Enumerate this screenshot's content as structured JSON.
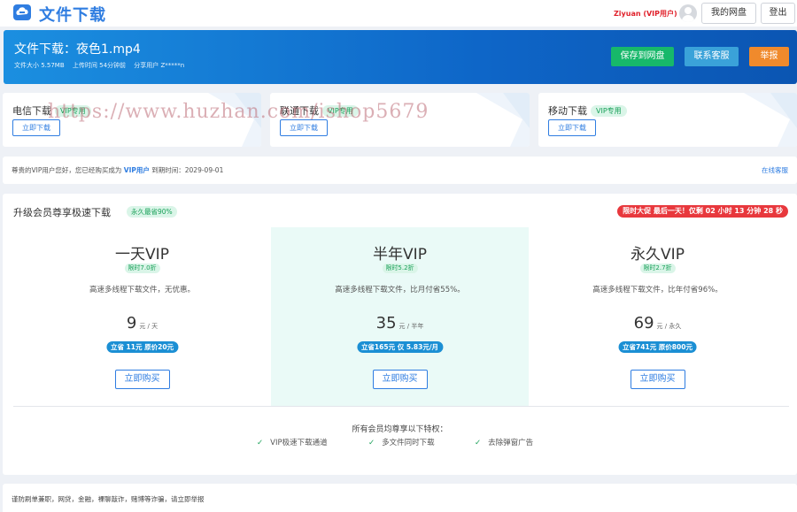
{
  "header": {
    "site_title": "文件下载",
    "user_name": "Ziyuan (VIP用户)",
    "my_disk_label": "我的网盘",
    "logout_label": "登出"
  },
  "file": {
    "title": "文件下载：夜色1.mp4",
    "size": "文件大小 5.57MB",
    "upload_time": "上传时间 54分钟前",
    "sharer": "分享用户 Z*****n",
    "save_label": "保存到网盘",
    "service_label": "联系客服",
    "report_label": "举报"
  },
  "downloads": [
    {
      "title": "电信下载",
      "tag": "VIP专用",
      "button": "立即下载"
    },
    {
      "title": "联通下载",
      "tag": "VIP专用",
      "button": "立即下载"
    },
    {
      "title": "移动下载",
      "tag": "VIP专用",
      "button": "立即下载"
    }
  ],
  "notice": {
    "prefix": "尊贵的VIP用户您好，您已经购买成为",
    "vip": "VIP用户",
    "suffix": "到期时间：2029-09-01",
    "link": "在线客服"
  },
  "vip": {
    "title": "升级会员尊享极速下载",
    "save_tag": "永久最省90%",
    "promo": "限时大促 最后一天！仅剩 02 小时 13 分钟 28 秒",
    "plans": [
      {
        "name": "一天VIP",
        "discount": "限时7.0折",
        "desc": "高速多线程下载文件，无优惠。",
        "price": "9",
        "unit": "元 / 天",
        "pill": "立省 11元 原价20元",
        "buy": "立即购买"
      },
      {
        "name": "半年VIP",
        "discount": "限时5.2折",
        "desc": "高速多线程下载文件，比月付省55%。",
        "price": "35",
        "unit": "元 / 半年",
        "pill": "立省165元 仅 5.83元/月",
        "buy": "立即购买"
      },
      {
        "name": "永久VIP",
        "discount": "限时2.7折",
        "desc": "高速多线程下载文件，比年付省96%。",
        "price": "69",
        "unit": "元 / 永久",
        "pill": "立省741元 原价800元",
        "buy": "立即购买"
      }
    ],
    "benefits_title": "所有会员均尊享以下特权：",
    "benefits": [
      "VIP极速下载通道",
      "多文件同时下载",
      "去除弹窗广告"
    ]
  },
  "footer": {
    "text": "谨防刷单兼职，网贷，金融，裸聊敲诈，赌博等诈骗，请立即举报"
  },
  "watermark": "https://www.huzhan.com/ishop5679",
  "colors": {
    "brand_blue": "#2f7de1",
    "banner_gradient_start": "#1b8fe0",
    "banner_gradient_end": "#0b55b2",
    "save_green": "#17b86a",
    "service_blue": "#3aa2d9",
    "report_orange": "#f08a2c",
    "promo_red": "#e8383d",
    "tag_green": "#18a058",
    "highlight_plan_bg": "#eafaf7"
  }
}
